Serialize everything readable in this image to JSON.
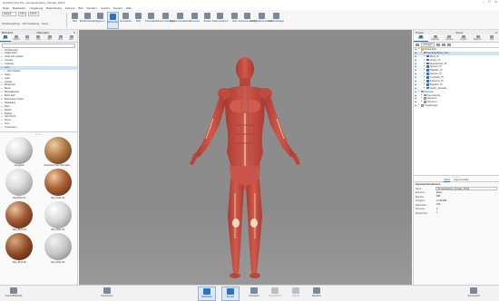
{
  "window": {
    "title": "KeyShot 10.2 Pro - Humananatomy_Female_HI.bip",
    "controls": [
      "–",
      "☐",
      "✕"
    ]
  },
  "menu": [
    "Datei",
    "Bearbeiten",
    "Umgebung",
    "Beleuchtung",
    "Kamera",
    "Bild",
    "Rendern",
    "Ansicht",
    "Fenster",
    "Hilfe"
  ],
  "toolbar": {
    "workspace_value": "Default",
    "cpu_label": "CPU",
    "zoom_value": "100 %",
    "small_row": [
      "Arbeitsumgebung",
      "CPU-Auslastung",
      "Pause"
    ],
    "buttons": [
      {
        "label": "GPU",
        "icon": "gpu-icon"
      },
      {
        "label": "Echtzeit-Render",
        "icon": "render-icon"
      },
      {
        "label": "Regionen",
        "icon": "region-icon"
      },
      {
        "label": "Schwenken",
        "icon": "pan-icon",
        "active": true
      },
      {
        "label": "Verschieben",
        "icon": "move-icon"
      },
      {
        "label": "Dolly",
        "icon": "dolly-icon"
      },
      {
        "label": "Perspektive",
        "icon": "perspective-icon"
      },
      {
        "label": "Kamera hinzufügen",
        "icon": "add-camera-icon"
      },
      {
        "label": "Kamera zurücksetzen",
        "icon": "reset-camera-icon"
      },
      {
        "label": "Geometrie",
        "icon": "geometry-icon"
      },
      {
        "label": "Studios",
        "icon": "studios-icon"
      },
      {
        "label": "Studio speichern",
        "icon": "save-studio-icon"
      },
      {
        "label": "Tools",
        "icon": "tools-icon"
      },
      {
        "label": "Geometrie-Ansicht",
        "icon": "geometry-view-icon"
      },
      {
        "label": "Konfigurations-Assistent",
        "icon": "configurator-icon"
      },
      {
        "label": "Lizenz-Manager",
        "icon": "license-icon"
      }
    ]
  },
  "left_panel": {
    "title": "Bibliothek",
    "subtitle": "Materialien",
    "tabs": [
      "Mater.",
      "Farben",
      "Text.",
      "Umg.",
      "Hint.",
      "Favo.",
      "Mod."
    ],
    "active_tab": 0,
    "categories": [
      {
        "label": "Architectural",
        "expanded": false
      },
      {
        "label": "Axalta Paint",
        "expanded": false
      },
      {
        "label": "Cloth and Leather",
        "expanded": false
      },
      {
        "label": "Contour",
        "expanded": false
      },
      {
        "label": "Cutaway",
        "expanded": false
      },
      {
        "label": "Fuzz",
        "expanded": true
      },
      {
        "label": "Gem Stones",
        "expanded": false,
        "child": true
      },
      {
        "label": "Glass",
        "expanded": false
      },
      {
        "label": "Light",
        "expanded": false
      },
      {
        "label": "Liquids",
        "expanded": false
      },
      {
        "label": "Measured",
        "expanded": false
      },
      {
        "label": "Metal",
        "expanded": false
      },
      {
        "label": "Miscellaneous",
        "expanded": false
      },
      {
        "label": "Mold-Tech",
        "expanded": false
      },
      {
        "label": "Multi-Layer Optics",
        "expanded": false
      },
      {
        "label": "Packaging",
        "expanded": false
      },
      {
        "label": "Paint",
        "expanded": false
      },
      {
        "label": "Plastic",
        "expanded": false
      },
      {
        "label": "Rubber",
        "expanded": false
      },
      {
        "label": "Soft Touch",
        "expanded": false
      },
      {
        "label": "Stone",
        "expanded": false
      },
      {
        "label": "Toon",
        "expanded": false
      },
      {
        "label": "Translucent",
        "expanded": false
      }
    ],
    "selected_category": 5,
    "materials": [
      {
        "name": "Greygrain",
        "style": "g1"
      },
      {
        "name": "Rosewood Sar Herringbo...",
        "style": "g2"
      },
      {
        "name": "Red.Brick #1",
        "style": "g3"
      },
      {
        "name": "Red_Brick #2",
        "style": "g4"
      },
      {
        "name": "Red_Brick #3",
        "style": "g5"
      },
      {
        "name": "Red_Brick #4",
        "style": "g6"
      },
      {
        "name": "Red_Brick #5",
        "style": "g7"
      },
      {
        "name": "Red_Brick #6",
        "style": "g8"
      }
    ]
  },
  "right_panel": {
    "title": "Projekt",
    "subtitle": "Szene",
    "tabs": [
      "Szene",
      "Material",
      "Kamera",
      "Umgeb.",
      "Beleuch.",
      "Bild"
    ],
    "active_tab": 0,
    "tools_dropdown": "Anzeigen",
    "tree": [
      {
        "label": "Modell-Sets",
        "indent": 0,
        "expanded": true,
        "color": "#f0b429"
      },
      {
        "label": "Humananatomy_Fem...",
        "indent": 1,
        "expanded": true,
        "color": "#8a96a3",
        "selected": true
      },
      {
        "label": "Skele_Hi",
        "indent": 2,
        "color": "#2a73c8"
      },
      {
        "label": "Urinary_Hi",
        "indent": 2,
        "color": "#2a73c8"
      },
      {
        "label": "Reproductive_Hi",
        "indent": 2,
        "color": "#2a73c8"
      },
      {
        "label": "Nervous_Hi",
        "indent": 2,
        "color": "#2a73c8"
      },
      {
        "label": "Digestive_Hi",
        "indent": 2,
        "color": "#2a73c8"
      },
      {
        "label": "Nervous_Hi",
        "indent": 2,
        "color": "#2a73c8"
      },
      {
        "label": "Lymphatic_Hi",
        "indent": 2,
        "color": "#2a73c8"
      },
      {
        "label": "Endocrine_Hi",
        "indent": 2,
        "color": "#2a73c8"
      },
      {
        "label": "Digestive_Hi",
        "indent": 2,
        "color": "#2a73c8"
      },
      {
        "label": "Cardio_Vascular_...",
        "indent": 2,
        "color": "#2a73c8"
      },
      {
        "label": "Kameras",
        "indent": 0,
        "expanded": true,
        "color": "#8a96a3"
      },
      {
        "label": "Free Camera",
        "indent": 1,
        "color": "#8a96a3"
      },
      {
        "label": "Camera 1",
        "indent": 1,
        "color": "#8a96a3"
      },
      {
        "label": "Camera 2",
        "indent": 1,
        "color": "#8a96a3"
      },
      {
        "label": "Umgebungen",
        "indent": 0,
        "expanded": false,
        "color": "#8a96a3"
      }
    ],
    "subtabs": [
      "Szene",
      "Eigenschaften"
    ],
    "properties_header": "Szeneninformationen",
    "properties": [
      {
        "key": "Name",
        "value": "Humananatomy_Female_Hi.bip",
        "box": true
      },
      {
        "key": "Einheiten",
        "value": "Meter",
        "box": false
      },
      {
        "key": "Bauteile",
        "value": "585",
        "box": false
      },
      {
        "key": "Polygone",
        "value": "2.413.488",
        "box": false
      },
      {
        "key": "Materialien",
        "value": "106",
        "box": false
      },
      {
        "key": "Kameras",
        "value": "2",
        "box": false
      },
      {
        "key": "Modell-Sets",
        "value": "1",
        "box": false
      }
    ]
  },
  "bottom_bar": {
    "buttons": [
      {
        "label": "Cloud-Bibliothek",
        "icon": "cloud-icon"
      },
      {
        "label": "Importieren",
        "icon": "import-icon"
      },
      {
        "label": "Bibliothek",
        "icon": "library-icon",
        "active": true
      },
      {
        "label": "Projekt",
        "icon": "project-icon",
        "active": true
      },
      {
        "label": "Animation",
        "icon": "animation-icon"
      },
      {
        "label": "KeyShotVR",
        "icon": "keyshotvr-icon",
        "dim": true
      },
      {
        "label": "KeyVR",
        "icon": "keyvr-icon",
        "dim": true
      },
      {
        "label": "Rendern",
        "icon": "render-output-icon"
      },
      {
        "label": "Screenshot",
        "icon": "screenshot-icon"
      }
    ]
  },
  "colors": {
    "accent": "#2a73c8",
    "viewport_bg": "#8c8c8c",
    "muscle": "#c24a3f",
    "bone": "#e9dcc0"
  }
}
